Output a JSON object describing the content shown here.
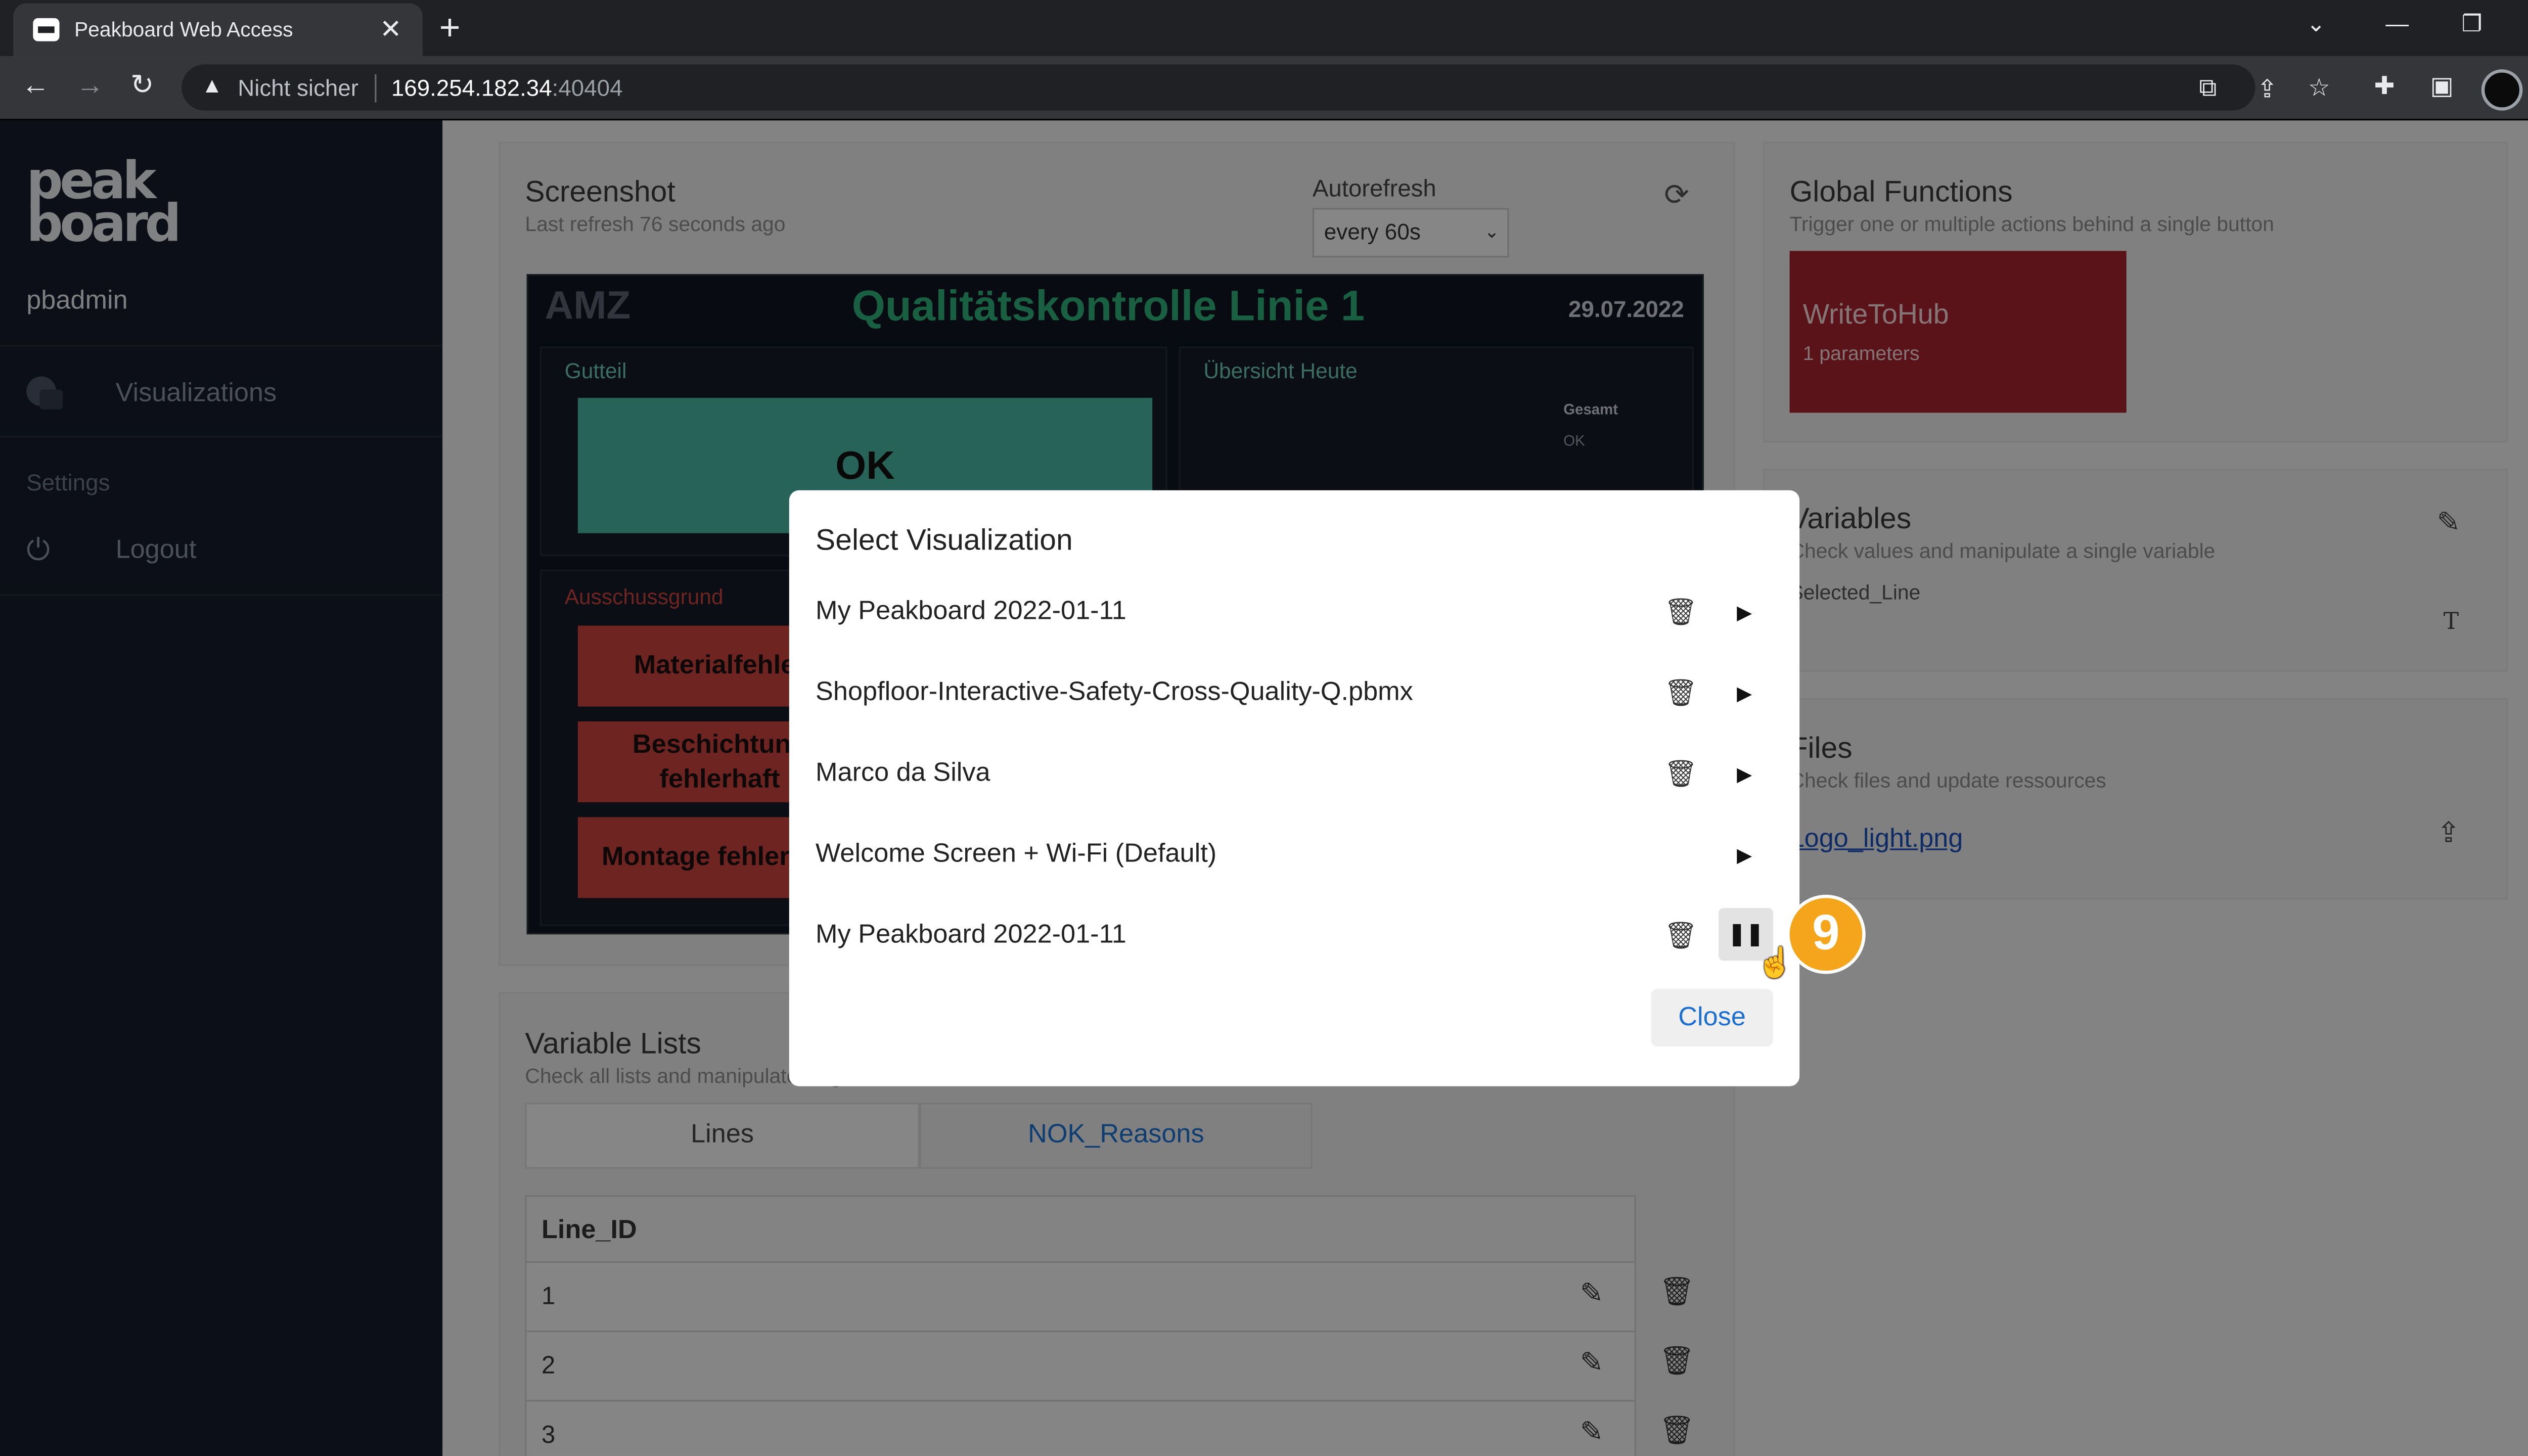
{
  "browser": {
    "tab_title": "Peakboard Web Access",
    "not_secure": "Nicht sicher",
    "url_host": "169.254.182.34",
    "url_port": ":40404"
  },
  "sidebar": {
    "logo": "peak board",
    "username": "pbadmin",
    "nav_visualizations": "Visualizations",
    "settings_label": "Settings",
    "nav_logout": "Logout"
  },
  "screenshot_card": {
    "title": "Screenshot",
    "subtitle": "Last refresh 76 seconds ago",
    "autorefresh_label": "Autorefresh",
    "autorefresh_value": "every 60s"
  },
  "dashboard": {
    "logo": "AMZ",
    "title": "Qualitätskontrolle Linie 1",
    "date": "29.07.2022",
    "panel_gutteil": "Gutteil",
    "ok_text": "OK",
    "panel_uebersicht": "Übersicht Heute",
    "gesamt": "Gesamt",
    "ok_small": "OK",
    "panel_ausschuss": "Ausschussgrund",
    "reasons": [
      "Materialfehler",
      "Beschichtung fehlerhaft",
      "Montage fehlerhaft"
    ]
  },
  "global_functions": {
    "title": "Global Functions",
    "subtitle": "Trigger one or multiple actions behind a single button",
    "function_name": "WriteToHub",
    "function_params": "1 parameters"
  },
  "variables": {
    "title": "Variables",
    "subtitle": "Check values and manipulate a single variable",
    "item": "Selected_Line",
    "type_icon": "T"
  },
  "files": {
    "title": "Files",
    "subtitle": "Check files and update ressources",
    "file": "Logo_light.png"
  },
  "variable_lists": {
    "title": "Variable Lists",
    "subtitle": "Check all lists and manipulate single entries",
    "tabs": [
      "Lines",
      "NOK_Reasons"
    ],
    "column_header": "Line_ID",
    "rows": [
      "1",
      "2",
      "3"
    ]
  },
  "modal": {
    "title": "Select Visualization",
    "items": [
      {
        "label": "My Peakboard 2022-01-11"
      },
      {
        "label": "Shopfloor-Interactive-Safety-Cross-Quality-Q.pbmx"
      },
      {
        "label": "Marco da Silva"
      },
      {
        "label": "Welcome Screen + Wi-Fi (Default)"
      },
      {
        "label": "My Peakboard 2022-01-11"
      }
    ],
    "close_label": "Close"
  },
  "step_badge": "9",
  "colors": {
    "accent_function": "#a3232f",
    "badge": "#f4a51c",
    "link": "#1a6fd0",
    "dashboard_green": "#2fb07a"
  }
}
